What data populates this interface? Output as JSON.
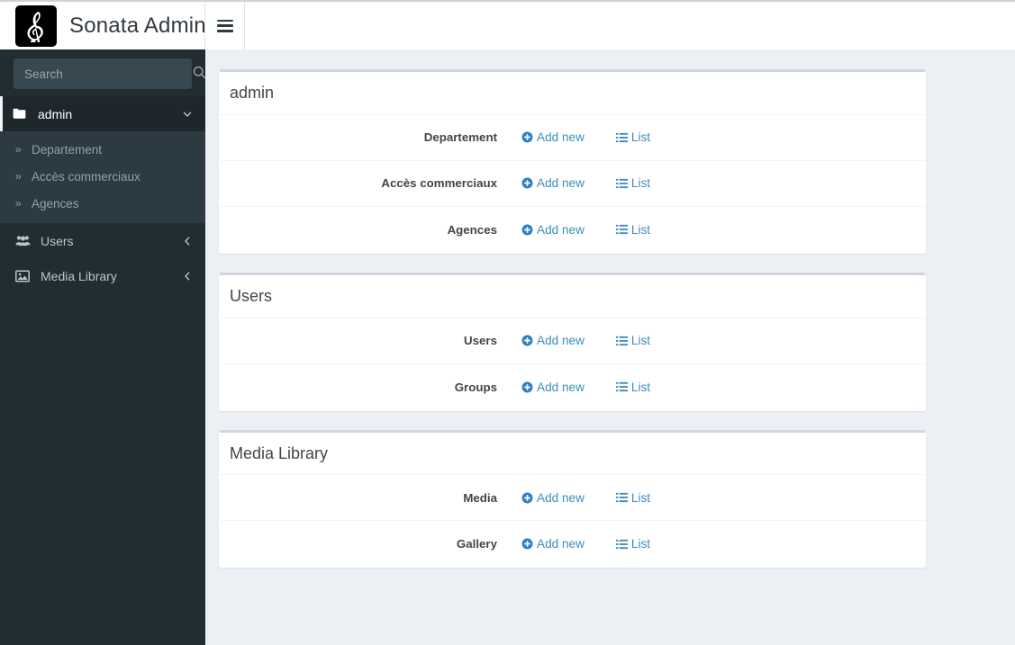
{
  "brand": {
    "title": "Sonata Admin",
    "logo_icon": "treble-clef-icon"
  },
  "header": {
    "nav_toggle_icon": "hamburger-icon"
  },
  "sidebar": {
    "search": {
      "placeholder": "Search",
      "value": "",
      "icon": "search-icon"
    },
    "items": [
      {
        "label": "admin",
        "icon": "folder-icon",
        "arrow_icon": "chevron-down-icon",
        "active": true,
        "children": [
          {
            "label": "Departement",
            "icon": "angle-double-right-icon"
          },
          {
            "label": "Accès commerciaux",
            "icon": "angle-double-right-icon"
          },
          {
            "label": "Agences",
            "icon": "angle-double-right-icon"
          }
        ]
      },
      {
        "label": "Users",
        "icon": "users-icon",
        "arrow_icon": "chevron-left-icon",
        "active": false,
        "children": []
      },
      {
        "label": "Media Library",
        "icon": "image-icon",
        "arrow_icon": "chevron-left-icon",
        "active": false,
        "children": []
      }
    ]
  },
  "actions": {
    "add_new_label": "Add new",
    "add_new_icon": "plus-circle-icon",
    "list_label": "List",
    "list_icon": "list-icon"
  },
  "colors": {
    "sidebar_bg": "#222d32",
    "submenu_bg": "#2c3b41",
    "content_bg": "#ecf0f5",
    "link_blue": "#3c8dbc",
    "panel_top_border": "#d2d6de"
  },
  "panels": [
    {
      "title": "admin",
      "rows": [
        {
          "label": "Departement"
        },
        {
          "label": "Accès commerciaux"
        },
        {
          "label": "Agences"
        }
      ]
    },
    {
      "title": "Users",
      "rows": [
        {
          "label": "Users"
        },
        {
          "label": "Groups"
        }
      ]
    },
    {
      "title": "Media Library",
      "rows": [
        {
          "label": "Media"
        },
        {
          "label": "Gallery"
        }
      ]
    }
  ]
}
